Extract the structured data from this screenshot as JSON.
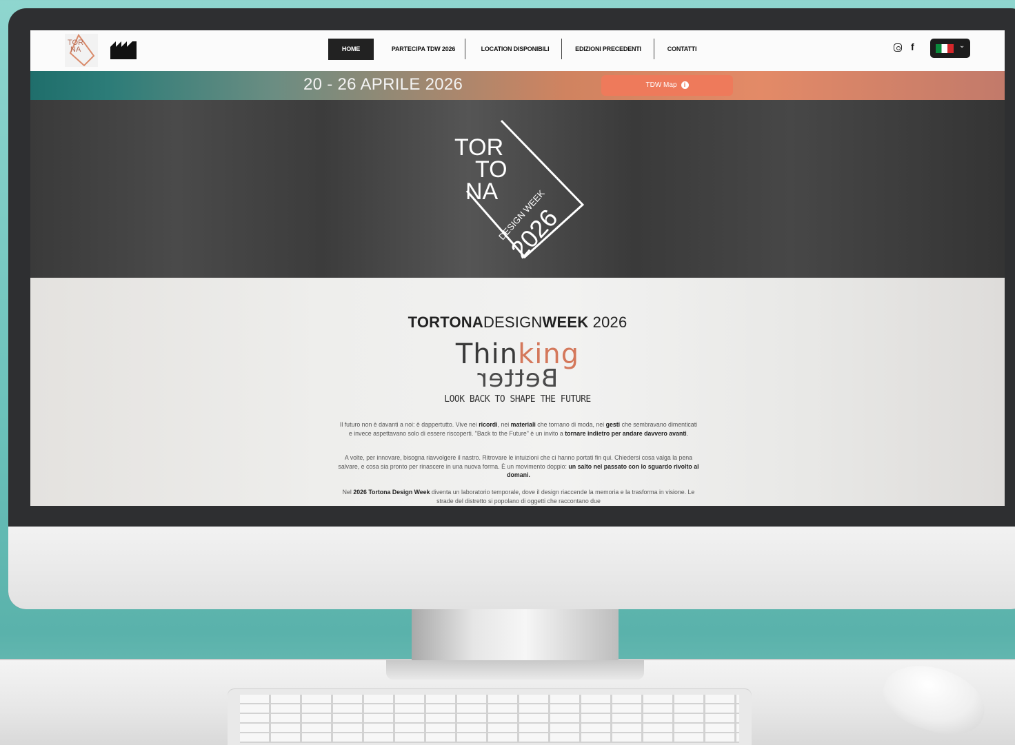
{
  "nav": {
    "items": [
      {
        "label": "HOME",
        "active": true
      },
      {
        "label": "PARTECIPA TDW 2026",
        "active": false
      },
      {
        "label": "LOCATION DISPONIBILI",
        "active": false
      },
      {
        "label": "EDIZIONI PRECEDENTI",
        "active": false
      },
      {
        "label": "CONTATTI",
        "active": false
      }
    ],
    "social": [
      "instagram-icon",
      "facebook-icon"
    ],
    "facebook_glyph": "f",
    "language": "it"
  },
  "banner": {
    "date": "20 - 26 APRILE 2026",
    "map_button": "TDW Map"
  },
  "hero_logo": {
    "lines": [
      "TOR",
      "TO",
      "NA"
    ],
    "subtitle": "DESIGN WEEK",
    "year": "2026"
  },
  "section": {
    "title_a": "TORTONA",
    "title_b": "DESIGN",
    "title_c": "WEEK",
    "title_d": " 2026",
    "thinking_a": "Thin",
    "thinking_b": "king",
    "better": "Better",
    "tagline": "LOOK BACK TO SHAPE THE FUTURE",
    "p1": {
      "a": "Il futuro non è davanti a noi: è dappertutto. Vive nei ",
      "b": "ricordi",
      "c": ", nei ",
      "d": "materiali",
      "e": " che tornano di moda, nei ",
      "f": "gesti",
      "g": " che sembravano dimenticati e invece aspettavano solo di essere riscoperti. \"Back to the Future\" è un invito a ",
      "h": "tornare indietro per andare davvero avanti",
      "i": "."
    },
    "p2": {
      "a": "A volte, per innovare, bisogna riavvolgere il nastro. Ritrovare le intuizioni che ci hanno portati fin qui. Chiedersi cosa valga la pena salvare, e cosa sia pronto per rinascere in una nuova forma. È un movimento doppio: ",
      "b": "un salto nel passato con lo sguardo rivolto al domani."
    },
    "p3": {
      "a": "Nel ",
      "b": "2026 Tortona Design Week",
      "c": " diventa un laboratorio temporale, dove il design riaccende la memoria e la trasforma in visione. Le strade del distretto si popolano di oggetti che raccontano due"
    }
  },
  "colors": {
    "accent": "#ee7a5b",
    "banner_teal": "#1f6e6b",
    "nav_active": "#222222"
  }
}
